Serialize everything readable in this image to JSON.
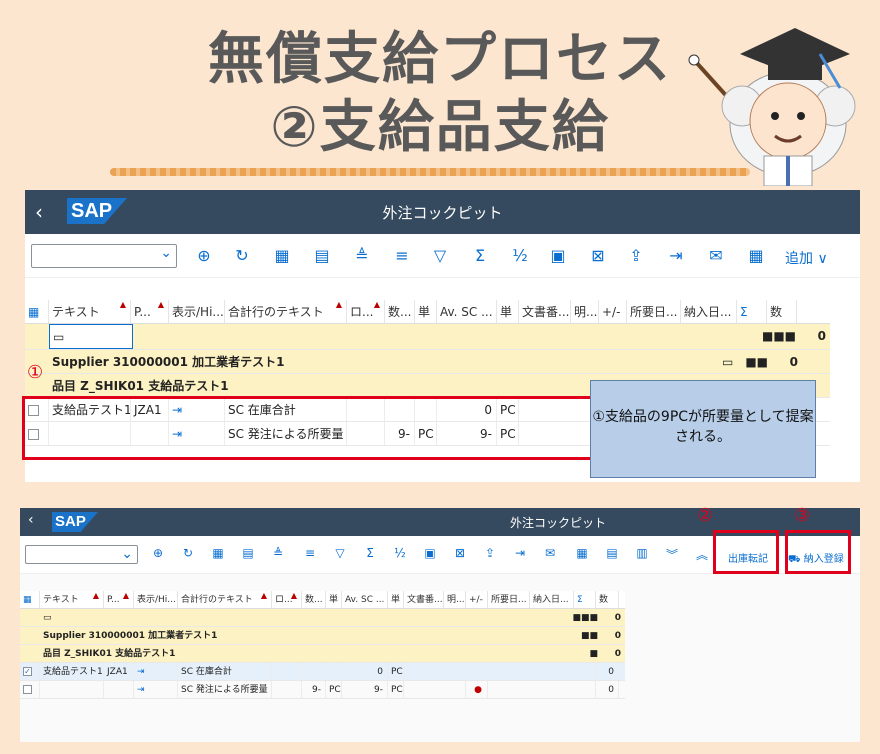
{
  "heading": {
    "line1": "無償支給プロセス",
    "line2": "②支給品支給"
  },
  "panel1": {
    "app_title": "外注コックピット",
    "more_label": "追加 ∨",
    "columns": [
      "テキスト",
      "P...",
      "表示/Hi...",
      "合計行のテキスト",
      "ロ...",
      "数...",
      "単",
      "Av. SC ...",
      "単",
      "文書番...",
      "明...",
      "+/-",
      "所要日...",
      "納入日...",
      "Σ",
      "数"
    ],
    "summary_row": {
      "value": "0",
      "dots": "■■■"
    },
    "supplier_row": {
      "text": "Supplier 310000001 加工業者テスト1",
      "dots": "■■",
      "value": "0"
    },
    "material_row": {
      "text": "品目 Z_SHIK01 支給品テスト1"
    },
    "rows": [
      {
        "text": "支給品テスト1",
        "p": "JZA1",
        "sum_text": "SC 在庫合計",
        "qty": "",
        "unit": "",
        "avsc": "0",
        "unit2": "PC"
      },
      {
        "text": "",
        "p": "",
        "sum_text": "SC 発注による所要量",
        "qty": "9-",
        "unit": "PC",
        "avsc": "9-",
        "unit2": "PC"
      }
    ],
    "marker": "①",
    "callout": "①支給品の9PCが所要量として提案される。"
  },
  "panel2": {
    "app_title": "外注コックピット",
    "post_goods_issue": "出庫転記",
    "delivery_register": "納入登録",
    "marker2": "②",
    "marker3": "③",
    "columns": [
      "テキスト",
      "P...",
      "表示/Hi...",
      "合計行のテキスト",
      "ロ...",
      "数...",
      "単",
      "Av. SC ...",
      "単",
      "文書番...",
      "明...",
      "+/-",
      "所要日...",
      "納入日...",
      "Σ",
      "数"
    ],
    "summary_row": {
      "value": "0",
      "dots": "■■■"
    },
    "supplier_row": {
      "text": "Supplier 310000001 加工業者テスト1",
      "dots": "■■",
      "value": "0"
    },
    "material_row": {
      "text": "品目 Z_SHIK01 支給品テスト1",
      "dots": "■",
      "value": "0"
    },
    "rows": [
      {
        "text": "支給品テスト1",
        "p": "JZA1",
        "sum_text": "SC 在庫合計",
        "qty": "",
        "unit": "",
        "avsc": "0",
        "unit2": "PC",
        "count": "0",
        "checked": "✓"
      },
      {
        "text": "",
        "p": "",
        "sum_text": "SC 発注による所要量",
        "qty": "9-",
        "unit": "PC",
        "avsc": "9-",
        "unit2": "PC",
        "count": "0",
        "checked": ""
      }
    ]
  },
  "colors": {
    "shell": "#354a5f",
    "accent": "#0a6ed1",
    "red": "#e0001b",
    "yellow_row": "#fdf2c3",
    "callout": "#b7cde8"
  }
}
